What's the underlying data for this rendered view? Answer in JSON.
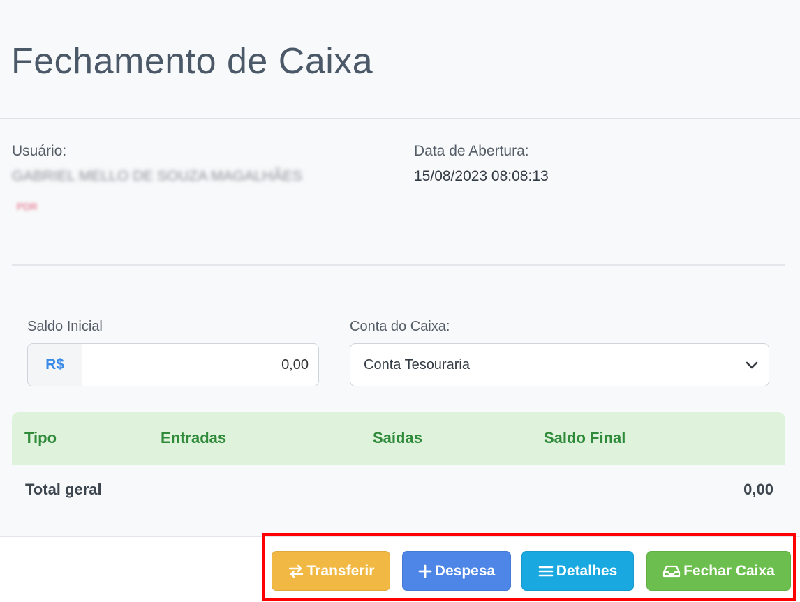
{
  "header": {
    "title": "Fechamento de Caixa"
  },
  "info": {
    "user_label": "Usuário:",
    "user_name": "GABRIEL MELLO DE SOUZA MAGALHÃES",
    "user_tag": "PDR",
    "open_date_label": "Data de Abertura:",
    "open_date_value": "15/08/2023 08:08:13"
  },
  "form": {
    "initial_balance_label": "Saldo Inicial",
    "currency_symbol": "R$",
    "initial_balance_value": "0,00",
    "account_label": "Conta do Caixa:",
    "account_selected": "Conta Tesouraria"
  },
  "table": {
    "headers": [
      "Tipo",
      "Entradas",
      "Saídas",
      "Saldo Final"
    ],
    "total_label": "Total geral",
    "total_value": "0,00"
  },
  "footer": {
    "buttons": [
      {
        "label": "Transferir",
        "icon": "arrows-swap-icon",
        "color": "#f1b943"
      },
      {
        "label": "Despesa",
        "icon": "plus-icon",
        "color": "#4d86e6"
      },
      {
        "label": "Detalhes",
        "icon": "list-icon",
        "color": "#19a9e0"
      },
      {
        "label": "Fechar Caixa",
        "icon": "inbox-icon",
        "color": "#6cbf4e"
      }
    ]
  },
  "colors": {
    "header_green_text": "#2f8a3a",
    "table_header_bg": "#dff3dc",
    "highlight_border": "#ff0000"
  }
}
